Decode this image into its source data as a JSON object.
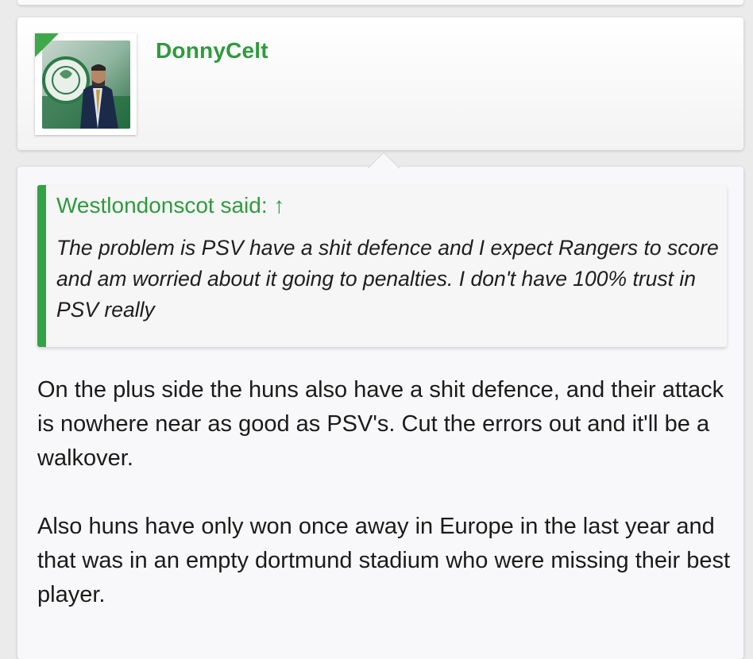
{
  "post": {
    "author": {
      "username": "DonnyCelt",
      "avatar_icon": "user-avatar-photo",
      "accent_color": "#2f9a3e"
    },
    "quote": {
      "author_label": "Westlondonscot said:",
      "jump_icon": "↑",
      "text": "The problem is PSV have a shit defence and I expect Rangers to score and am worried about it going to penalties. I don't have 100% trust in PSV really"
    },
    "paragraphs": [
      "On the plus side the huns also have a shit defence, and their attack is nowhere near as good as PSV's. Cut the errors out and it'll be a walkover.",
      "Also huns have only won once away in Europe in the last year and that was in an empty dortmund stadium who were missing their best player."
    ]
  }
}
